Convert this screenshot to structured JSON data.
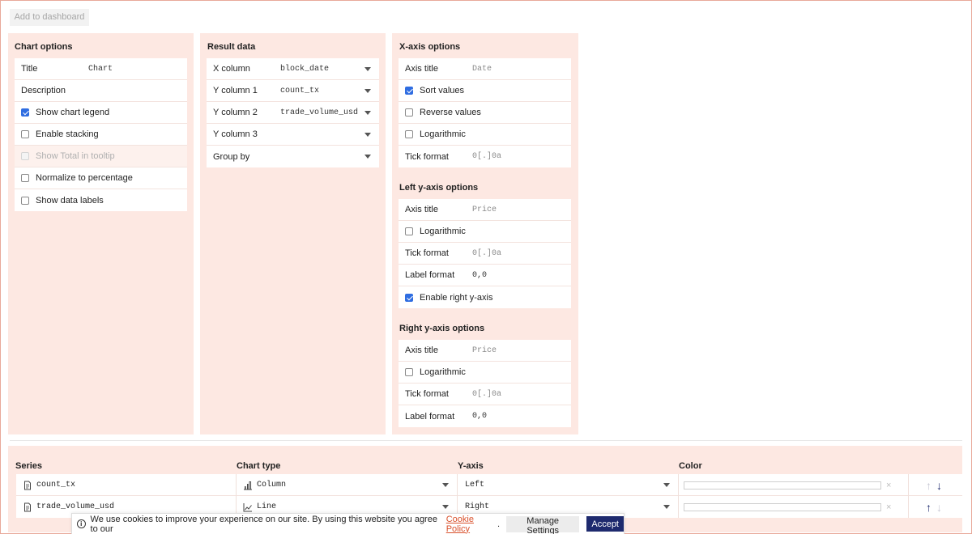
{
  "toolbar": {
    "add_to_dashboard": "Add to dashboard"
  },
  "chart_options": {
    "title": "Chart options",
    "title_label": "Title",
    "title_value": "Chart",
    "description_label": "Description",
    "show_chart_legend": "Show chart legend",
    "enable_stacking": "Enable stacking",
    "show_total_tooltip": "Show Total in tooltip",
    "normalize_percentage": "Normalize to percentage",
    "show_data_labels": "Show data labels"
  },
  "result_data": {
    "title": "Result data",
    "x_column_label": "X column",
    "x_column_value": "block_date",
    "y1_label": "Y column 1",
    "y1_value": "count_tx",
    "y2_label": "Y column 2",
    "y2_value": "trade_volume_usd",
    "y3_label": "Y column 3",
    "group_by_label": "Group by"
  },
  "x_axis": {
    "title": "X-axis options",
    "axis_title_label": "Axis title",
    "axis_title_placeholder": "Date",
    "sort_values": "Sort values",
    "reverse_values": "Reverse values",
    "logarithmic": "Logarithmic",
    "tick_format_label": "Tick format",
    "tick_format_placeholder": "0[.]0a"
  },
  "left_y_axis": {
    "title": "Left y-axis options",
    "axis_title_label": "Axis title",
    "axis_title_placeholder": "Price",
    "logarithmic": "Logarithmic",
    "tick_format_label": "Tick format",
    "tick_format_placeholder": "0[.]0a",
    "label_format_label": "Label format",
    "label_format_value": "0,0",
    "enable_right_y_axis": "Enable right y-axis"
  },
  "right_y_axis": {
    "title": "Right y-axis options",
    "axis_title_label": "Axis title",
    "axis_title_placeholder": "Price",
    "logarithmic": "Logarithmic",
    "tick_format_label": "Tick format",
    "tick_format_placeholder": "0[.]0a",
    "label_format_label": "Label format",
    "label_format_value": "0,0"
  },
  "series_table": {
    "headers": {
      "series": "Series",
      "chart_type": "Chart type",
      "y_axis": "Y-axis",
      "color": "Color"
    },
    "rows": [
      {
        "name": "count_tx",
        "chart_type": "Column",
        "y_axis": "Left"
      },
      {
        "name": "trade_volume_usd",
        "chart_type": "Line",
        "y_axis": "Right"
      }
    ]
  },
  "cookie_banner": {
    "text": "We use cookies to improve your experience on our site. By using this website you agree to our",
    "link": "Cookie Policy",
    "period": ".",
    "manage": "Manage Settings",
    "accept": "Accept"
  }
}
